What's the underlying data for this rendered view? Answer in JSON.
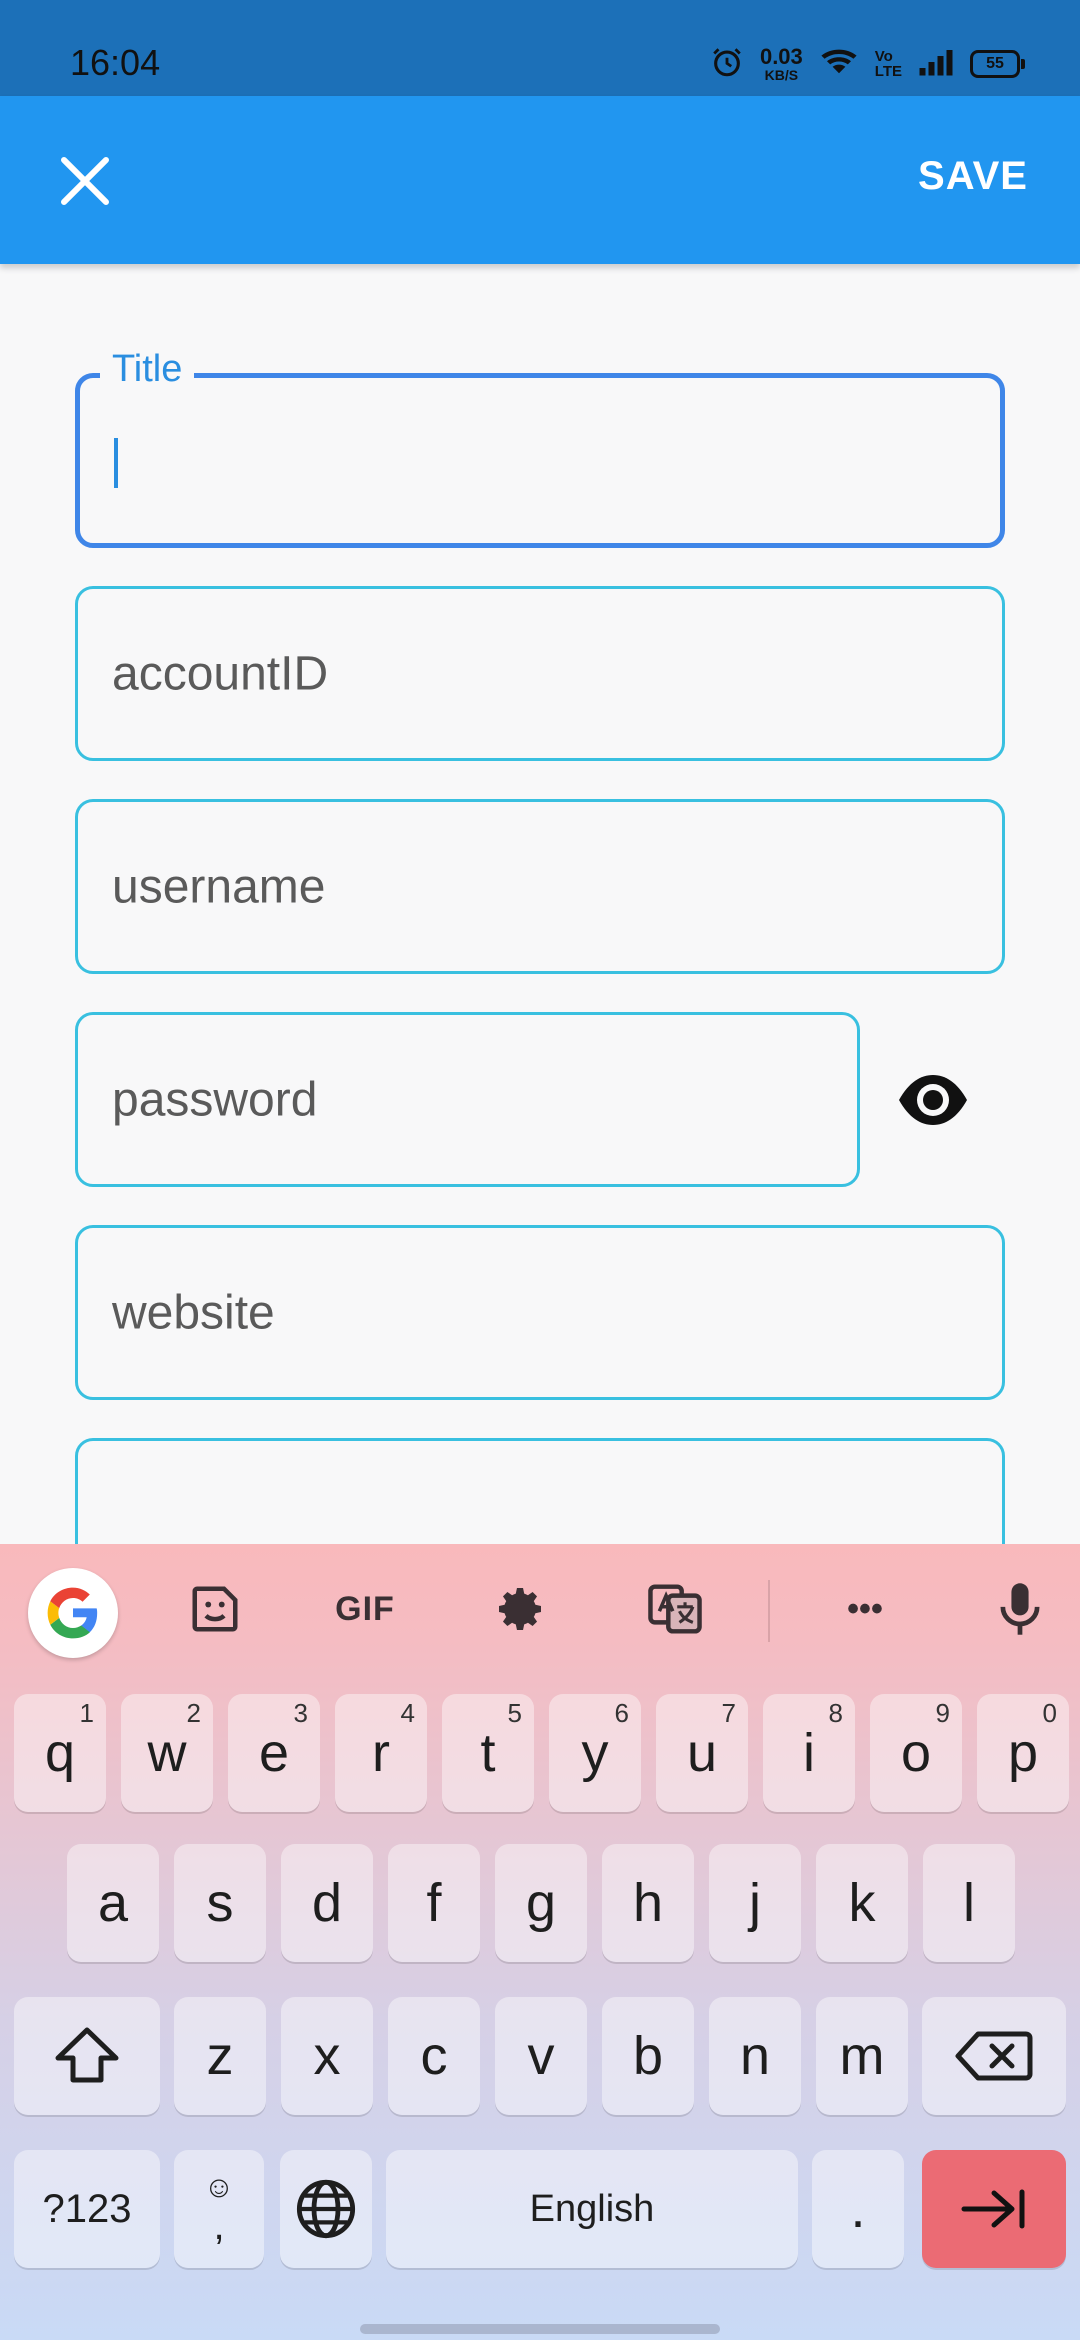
{
  "status_bar": {
    "time": "16:04",
    "net_speed_value": "0.03",
    "net_speed_unit": "KB/S",
    "volte_top": "Vo",
    "volte_bottom": "LTE",
    "battery": "55"
  },
  "app_bar": {
    "save_label": "SAVE"
  },
  "form": {
    "title_label": "Title",
    "account_placeholder": "accountID",
    "username_placeholder": "username",
    "password_placeholder": "password",
    "website_placeholder": "website"
  },
  "keyboard": {
    "toolbar": {
      "gif_label": "GIF",
      "more_label": "•••"
    },
    "row1": [
      {
        "k": "q",
        "n": "1"
      },
      {
        "k": "w",
        "n": "2"
      },
      {
        "k": "e",
        "n": "3"
      },
      {
        "k": "r",
        "n": "4"
      },
      {
        "k": "t",
        "n": "5"
      },
      {
        "k": "y",
        "n": "6"
      },
      {
        "k": "u",
        "n": "7"
      },
      {
        "k": "i",
        "n": "8"
      },
      {
        "k": "o",
        "n": "9"
      },
      {
        "k": "p",
        "n": "0"
      }
    ],
    "row2": [
      "a",
      "s",
      "d",
      "f",
      "g",
      "h",
      "j",
      "k",
      "l"
    ],
    "row3": [
      "z",
      "x",
      "c",
      "v",
      "b",
      "n",
      "m"
    ],
    "symbols_label": "?123",
    "emoji_top": "☺",
    "emoji_bottom": ",",
    "space_label": "English",
    "period_label": "."
  },
  "colors": {
    "app_bar": "#2196f0",
    "status_bar": "#1c70b8",
    "field_border": "#39c0e0",
    "focused_border": "#3f86e8",
    "enter_key": "#eb6b74"
  }
}
